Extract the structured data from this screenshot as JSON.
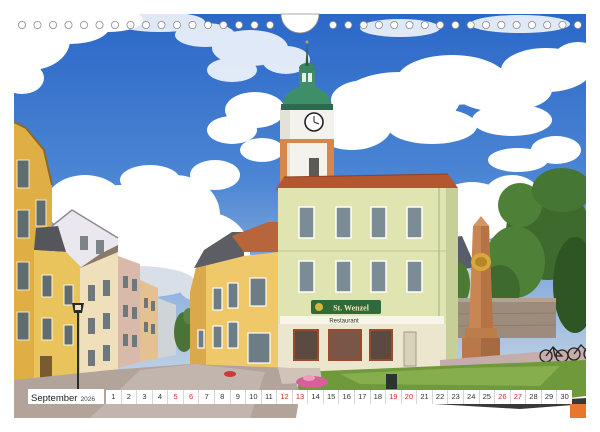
{
  "calendar": {
    "month": "September",
    "year": "2026",
    "days": [
      1,
      2,
      3,
      4,
      5,
      6,
      7,
      8,
      9,
      10,
      11,
      12,
      13,
      14,
      15,
      16,
      17,
      18,
      19,
      20,
      21,
      22,
      23,
      24,
      25,
      26,
      27,
      28,
      29,
      30
    ],
    "weekend_days": [
      5,
      6,
      12,
      13,
      19,
      20,
      26,
      27
    ]
  },
  "photo": {
    "sign_text": "St. Wenzel",
    "awning_text": "Restaurant"
  },
  "colors": {
    "weekday_text": "#333333",
    "weekend_text": "#d42a2a",
    "accent_tab": "#e8762c"
  }
}
